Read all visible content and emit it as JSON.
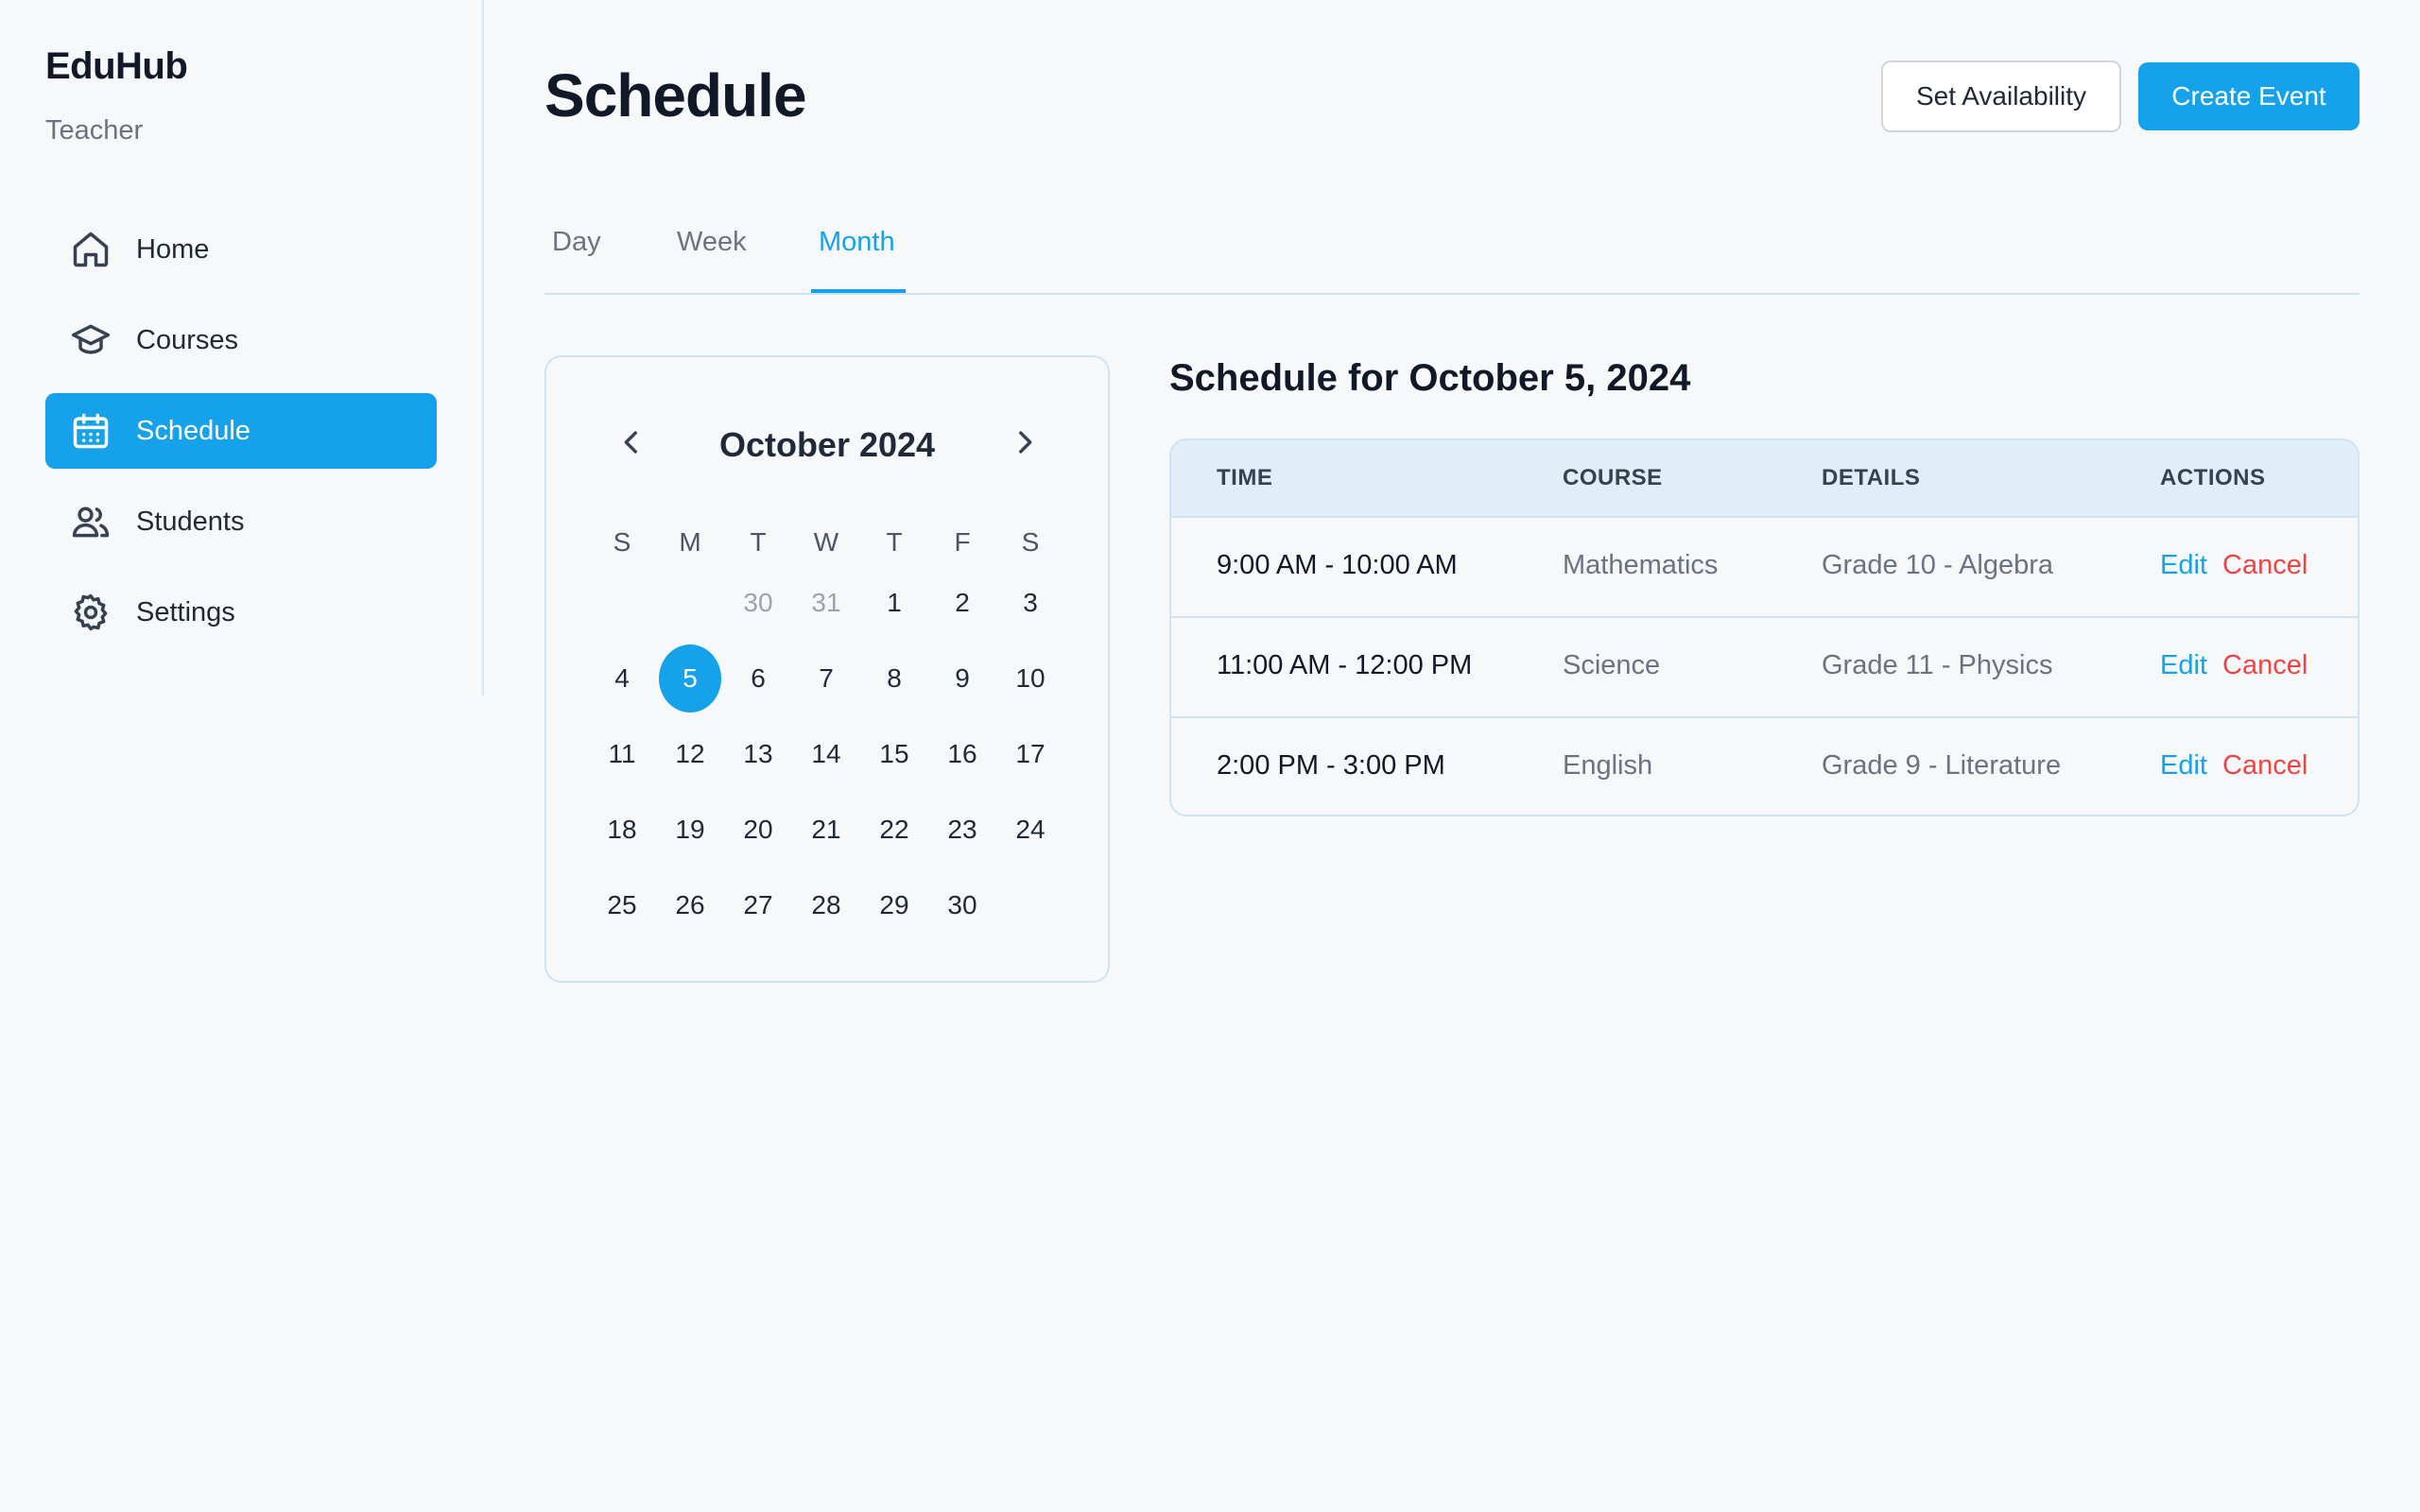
{
  "sidebar": {
    "brand": "EduHub",
    "role": "Teacher",
    "items": [
      {
        "label": "Home",
        "icon": "home-icon"
      },
      {
        "label": "Courses",
        "icon": "graduation-cap-icon"
      },
      {
        "label": "Schedule",
        "icon": "calendar-icon",
        "active": true
      },
      {
        "label": "Students",
        "icon": "users-icon"
      },
      {
        "label": "Settings",
        "icon": "gear-icon"
      }
    ]
  },
  "header": {
    "title": "Schedule",
    "set_availability_label": "Set Availability",
    "create_event_label": "Create Event"
  },
  "tabs": [
    {
      "label": "Day"
    },
    {
      "label": "Week"
    },
    {
      "label": "Month",
      "active": true
    }
  ],
  "calendar": {
    "title": "October 2024",
    "weekdays": [
      "S",
      "M",
      "T",
      "W",
      "T",
      "F",
      "S"
    ],
    "weeks": [
      [
        {
          "d": ""
        },
        {
          "d": ""
        },
        {
          "d": "30",
          "muted": true
        },
        {
          "d": "31",
          "muted": true
        },
        {
          "d": "1"
        },
        {
          "d": "2"
        },
        {
          "d": "3"
        }
      ],
      [
        {
          "d": "4"
        },
        {
          "d": "5",
          "selected": true
        },
        {
          "d": "6"
        },
        {
          "d": "7"
        },
        {
          "d": "8"
        },
        {
          "d": "9"
        },
        {
          "d": "10"
        }
      ],
      [
        {
          "d": "11"
        },
        {
          "d": "12"
        },
        {
          "d": "13"
        },
        {
          "d": "14"
        },
        {
          "d": "15"
        },
        {
          "d": "16"
        },
        {
          "d": "17"
        }
      ],
      [
        {
          "d": "18"
        },
        {
          "d": "19"
        },
        {
          "d": "20"
        },
        {
          "d": "21"
        },
        {
          "d": "22"
        },
        {
          "d": "23"
        },
        {
          "d": "24"
        }
      ],
      [
        {
          "d": "25"
        },
        {
          "d": "26"
        },
        {
          "d": "27"
        },
        {
          "d": "28"
        },
        {
          "d": "29"
        },
        {
          "d": "30"
        },
        {
          "d": ""
        }
      ]
    ]
  },
  "schedule": {
    "title": "Schedule for October 5, 2024",
    "columns": [
      "TIME",
      "COURSE",
      "DETAILS",
      "ACTIONS"
    ],
    "rows": [
      {
        "time": "9:00 AM - 10:00 AM",
        "course": "Mathematics",
        "details": "Grade 10 - Algebra",
        "edit": "Edit",
        "cancel": "Cancel"
      },
      {
        "time": "11:00 AM - 12:00 PM",
        "course": "Science",
        "details": "Grade 11 - Physics",
        "edit": "Edit",
        "cancel": "Cancel"
      },
      {
        "time": "2:00 PM - 3:00 PM",
        "course": "English",
        "details": "Grade 9 - Literature",
        "edit": "Edit",
        "cancel": "Cancel"
      }
    ]
  },
  "colors": {
    "accent": "#15a2ea",
    "danger": "#ef4444",
    "background": "#f6f8fa"
  }
}
